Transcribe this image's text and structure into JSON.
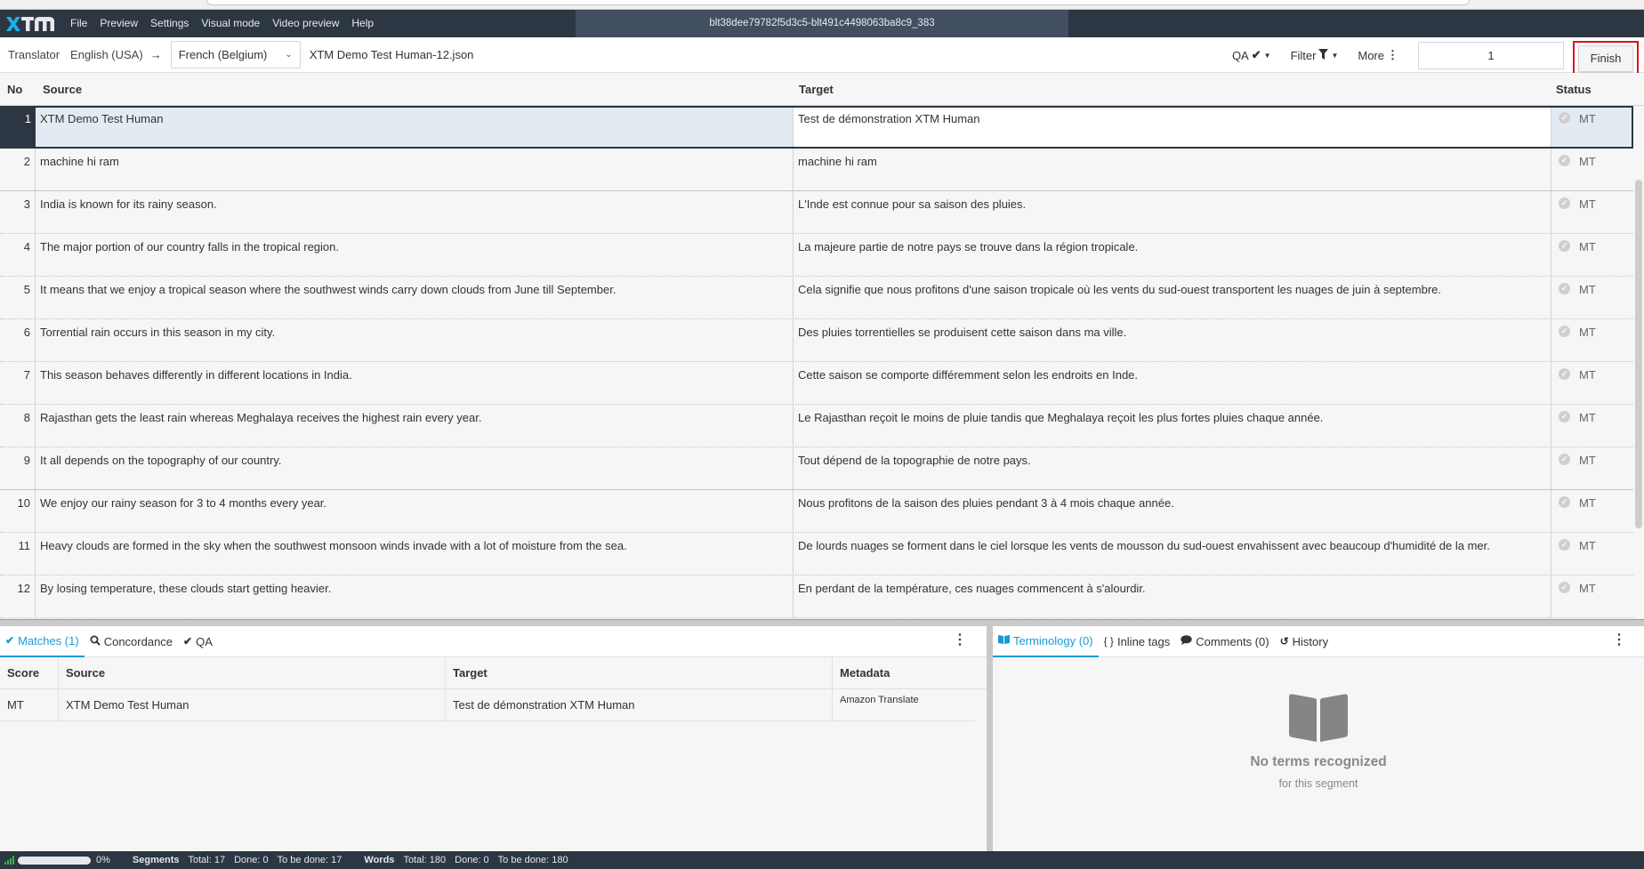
{
  "header": {
    "menu": [
      "File",
      "Preview",
      "Settings",
      "Visual mode",
      "Video preview",
      "Help"
    ],
    "document_id": "blt38dee79782f5d3c5-blt491c4498063ba8c9_383",
    "logo_text": "XTM"
  },
  "toolbar": {
    "role": "Translator",
    "source_language": "English (USA)",
    "arrow": "→",
    "target_language": "French (Belgium)",
    "file_name": "XTM Demo Test Human-12.json",
    "qa_label": "QA",
    "filter_label": "Filter",
    "more_label": "More",
    "segment_input_value": "1",
    "finish_label": "Finish"
  },
  "grid": {
    "columns": {
      "no": "No",
      "source": "Source",
      "target": "Target",
      "status": "Status"
    },
    "rows": [
      {
        "no": "1",
        "source": "XTM Demo Test Human",
        "target": "Test de démonstration XTM Human",
        "status": "MT"
      },
      {
        "no": "2",
        "source": "machine hi ram",
        "target": "machine hi ram",
        "status": "MT"
      },
      {
        "no": "3",
        "source": "India is known for its rainy season.",
        "target": "L'Inde est connue pour sa saison des pluies.",
        "status": "MT"
      },
      {
        "no": "4",
        "source": "The major portion of our country falls in the tropical region.",
        "target": "La majeure partie de notre pays se trouve dans la région tropicale.",
        "status": "MT"
      },
      {
        "no": "5",
        "source": "It means that we enjoy a tropical season where the southwest winds carry down clouds from June till September.",
        "target": "Cela signifie que nous profitons d'une saison tropicale où les vents du sud-ouest transportent les nuages de juin à septembre.",
        "status": "MT"
      },
      {
        "no": "6",
        "source": "Torrential rain occurs in this season in my city.",
        "target": "Des pluies torrentielles se produisent cette saison dans ma ville.",
        "status": "MT"
      },
      {
        "no": "7",
        "source": "This season behaves differently in different locations in India.",
        "target": "Cette saison se comporte différemment selon les endroits en Inde.",
        "status": "MT"
      },
      {
        "no": "8",
        "source": "Rajasthan gets the least rain whereas Meghalaya receives the highest rain every year.",
        "target": "Le Rajasthan reçoit le moins de pluie tandis que Meghalaya reçoit les plus fortes pluies chaque année.",
        "status": "MT"
      },
      {
        "no": "9",
        "source": "It all depends on the topography of our country.",
        "target": "Tout dépend de la topographie de notre pays.",
        "status": "MT"
      },
      {
        "no": "10",
        "source": "We enjoy our rainy season for 3 to 4 months every year.",
        "target": "Nous profitons de la saison des pluies pendant 3 à 4 mois chaque année.",
        "status": "MT"
      },
      {
        "no": "11",
        "source": "Heavy clouds are formed in the sky when the southwest monsoon winds invade with a lot of moisture from the sea.",
        "target": "De lourds nuages se forment dans le ciel lorsque les vents de mousson du sud-ouest envahissent avec beaucoup d'humidité de la mer.",
        "status": "MT"
      },
      {
        "no": "12",
        "source": "By losing temperature, these clouds start getting heavier.",
        "target": "En perdant de la température, ces nuages commencent à s'alourdir.",
        "status": "MT"
      }
    ]
  },
  "matches_panel": {
    "tabs": [
      {
        "label": "Matches (1)",
        "icon": "check-icon",
        "active": true
      },
      {
        "label": "Concordance",
        "icon": "search-icon",
        "active": false
      },
      {
        "label": "QA",
        "icon": "double-check-icon",
        "active": false
      }
    ],
    "columns": {
      "score": "Score",
      "source": "Source",
      "target": "Target",
      "metadata": "Metadata"
    },
    "rows": [
      {
        "score": "MT",
        "source": "XTM Demo Test Human",
        "target": "Test de démonstration XTM Human",
        "metadata": "Amazon Translate"
      }
    ]
  },
  "terminology_panel": {
    "tabs": [
      {
        "label": "Terminology (0)",
        "icon": "book-icon",
        "active": true
      },
      {
        "label": "Inline tags",
        "icon": "braces-icon",
        "active": false
      },
      {
        "label": "Comments (0)",
        "icon": "comment-icon",
        "active": false
      },
      {
        "label": "History",
        "icon": "history-icon",
        "active": false
      }
    ],
    "empty_title": "No terms recognized",
    "empty_subtitle": "for this segment"
  },
  "statusbar": {
    "progress_percent": 0,
    "progress_label": "0%",
    "segments_label": "Segments",
    "segments_total": "Total: 17",
    "segments_done": "Done: 0",
    "segments_todo": "To be done: 17",
    "words_label": "Words",
    "words_total": "Total: 180",
    "words_done": "Done: 0",
    "words_todo": "To be done: 180"
  },
  "colors": {
    "header_bg": "#2d3643",
    "accent": "#1a9bd7",
    "highlight_border": "#e1101a",
    "progress": "#3cb44b"
  }
}
